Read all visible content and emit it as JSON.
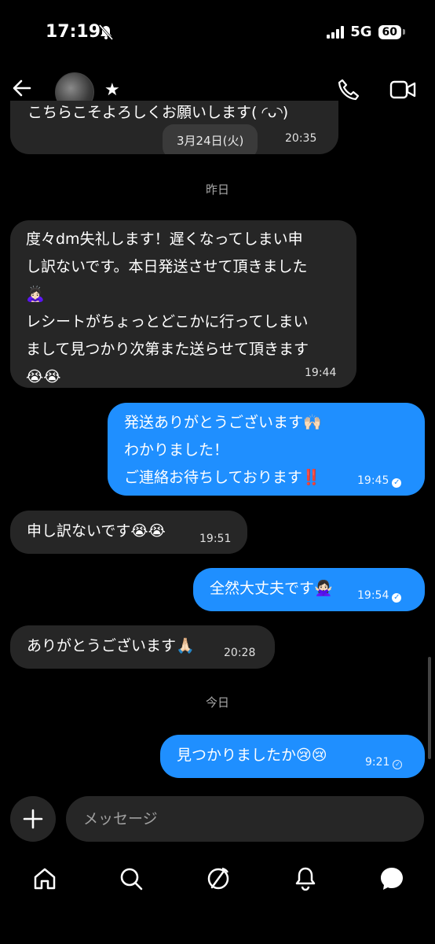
{
  "status": {
    "time": "17:19",
    "network": "5G",
    "battery": "60"
  },
  "messages": [
    {
      "dir": "in",
      "text": "こちらこそよろしくお願いします( ◜ᴗ◝)",
      "date_chip": "3月24日(火)",
      "time": "20:35"
    },
    {
      "dir": "divider",
      "text": "昨日"
    },
    {
      "dir": "in",
      "lines": [
        "度々dm失礼します！遅くなってしまい申",
        "し訳ないです。本日発送させて頂きました",
        "🙇🏻‍♀️",
        "レシートがちょっとどこかに行ってしまい",
        "まして見つかり次第また送らせて頂きます",
        "😭😭"
      ],
      "time": "19:44"
    },
    {
      "dir": "out",
      "lines": [
        "発送ありがとうございます🙌🏻",
        "わかりました！",
        "ご連絡お待ちしております‼️"
      ],
      "time": "19:45"
    },
    {
      "dir": "in",
      "text": "申し訳ないです😭😭",
      "time": "19:51"
    },
    {
      "dir": "out",
      "text": "全然大丈夫です🙅🏻‍♀️",
      "time": "19:54"
    },
    {
      "dir": "in",
      "text": "ありがとうございます🙏🏻",
      "time": "20:28"
    },
    {
      "dir": "divider",
      "text": "今日"
    },
    {
      "dir": "out",
      "text": "見つかりましたか😢😢",
      "time": "9:21"
    }
  ],
  "composer": {
    "placeholder": "メッセージ"
  },
  "nav": [
    "home-icon",
    "search-icon",
    "explore-icon",
    "notifications-icon",
    "messages-icon"
  ],
  "colors": {
    "out_bubble": "#1f8fff",
    "in_bubble": "#262626",
    "background": "#000000"
  }
}
